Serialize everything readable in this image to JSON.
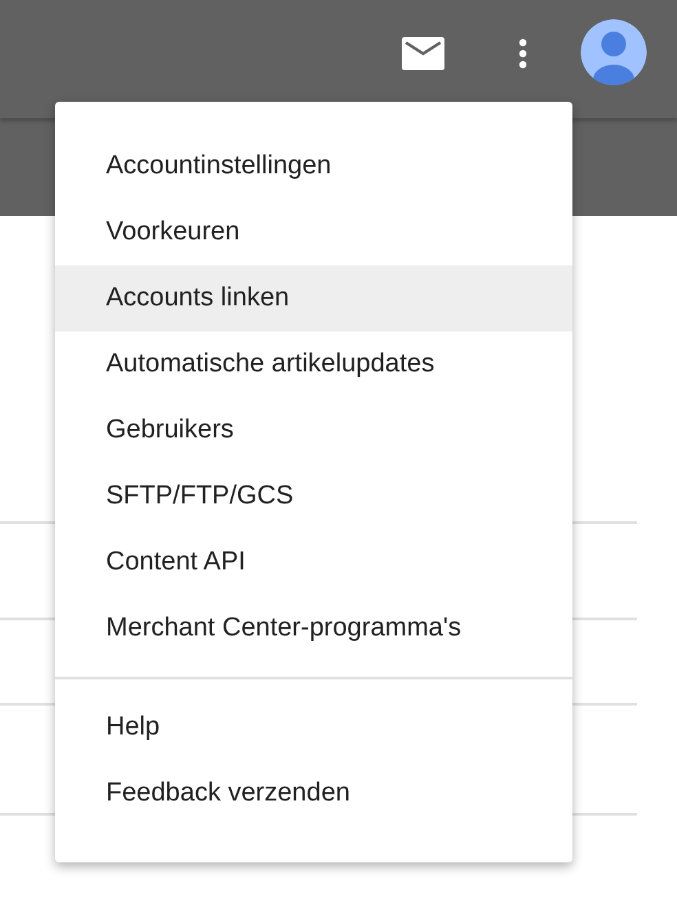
{
  "menu": {
    "sections": [
      {
        "items": [
          {
            "label": "Accountinstellingen",
            "selected": false
          },
          {
            "label": "Voorkeuren",
            "selected": false
          },
          {
            "label": "Accounts linken",
            "selected": true
          },
          {
            "label": "Automatische artikelupdates",
            "selected": false
          },
          {
            "label": "Gebruikers",
            "selected": false
          },
          {
            "label": "SFTP/FTP/GCS",
            "selected": false
          },
          {
            "label": "Content API",
            "selected": false
          },
          {
            "label": "Merchant Center-programma's",
            "selected": false
          }
        ]
      },
      {
        "items": [
          {
            "label": "Help",
            "selected": false
          },
          {
            "label": "Feedback verzenden",
            "selected": false
          }
        ]
      }
    ]
  }
}
